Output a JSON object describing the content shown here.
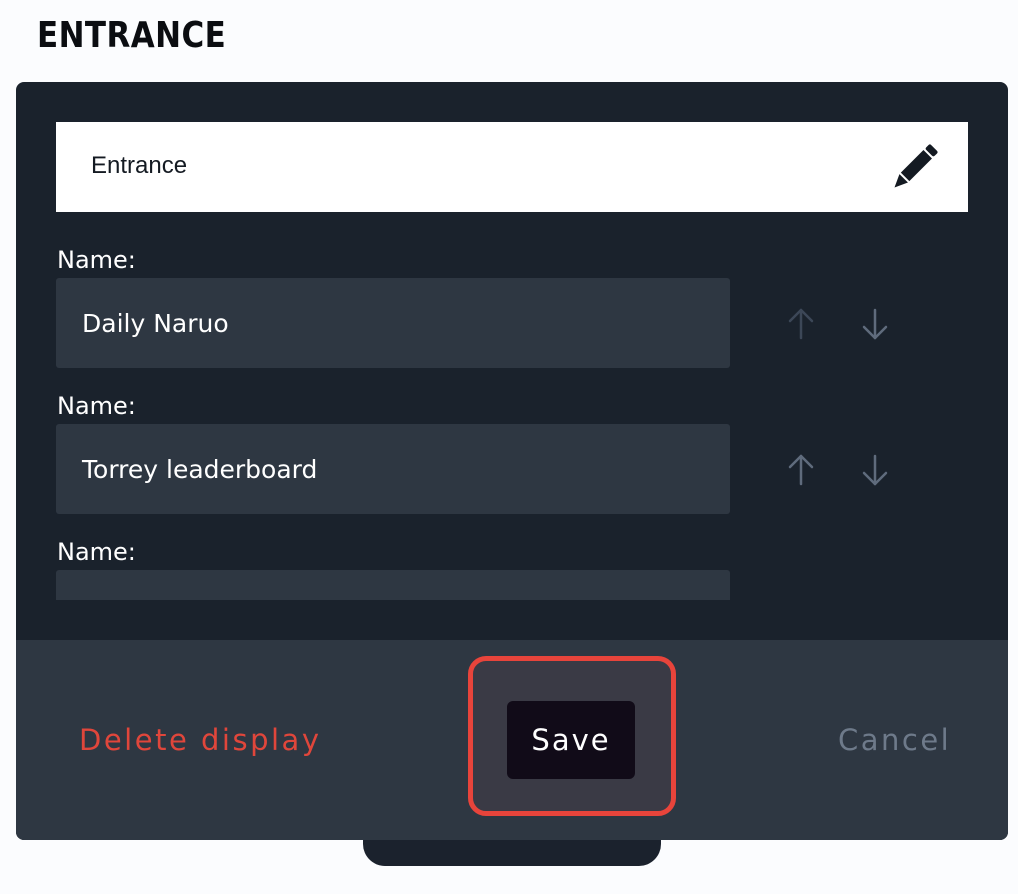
{
  "header": {
    "title": "ENTRANCE"
  },
  "display": {
    "title_value": "Entrance",
    "edit_icon": "pencil-icon"
  },
  "items": [
    {
      "label": "Name:",
      "value": "Daily Naruo"
    },
    {
      "label": "Name:",
      "value": "Torrey leaderboard"
    },
    {
      "label": "Name:",
      "value": ""
    }
  ],
  "icons": {
    "move_up": "arrow-up-icon",
    "move_down": "arrow-down-icon"
  },
  "footer": {
    "delete_label": "Delete display",
    "save_label": "Save",
    "cancel_label": "Cancel"
  },
  "colors": {
    "panel_background": "#1a222c",
    "input_background": "#2e3742",
    "delete_text": "#e0463b",
    "cancel_text": "#6e7a8a",
    "save_background": "#110b18",
    "highlight_border": "#e8443b",
    "arrow_icon": "#5f6b7c"
  }
}
